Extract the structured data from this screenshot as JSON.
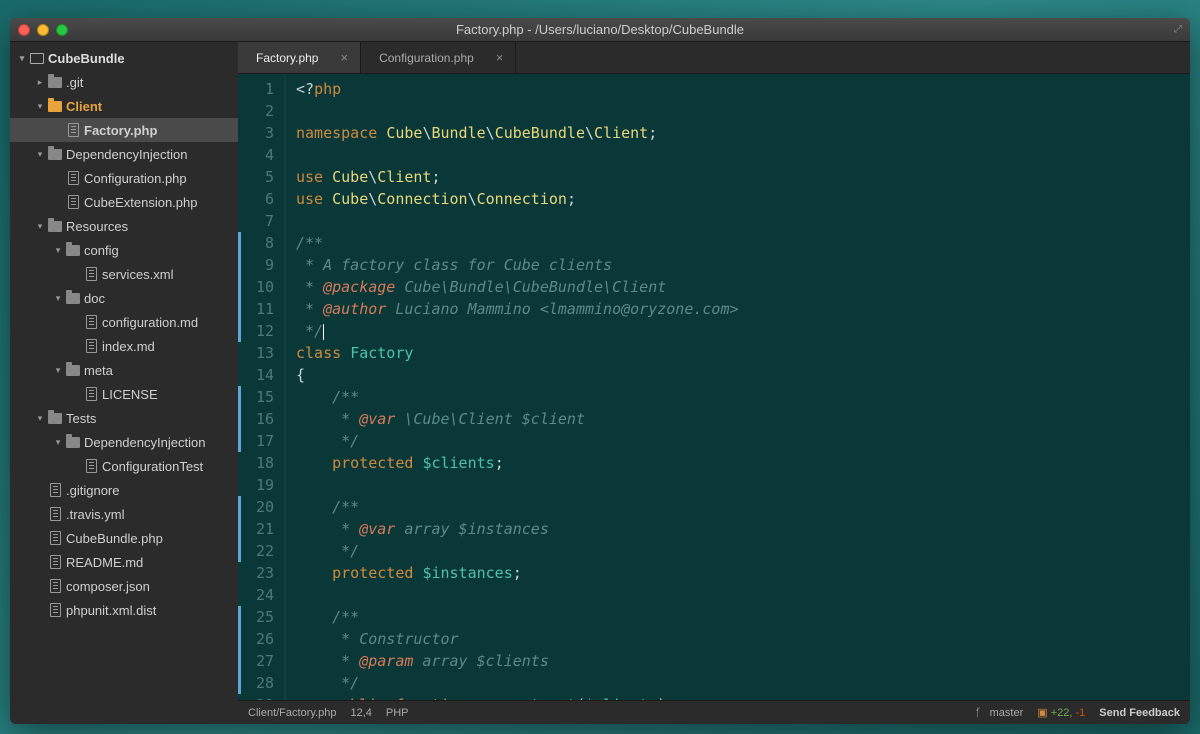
{
  "window": {
    "title": "Factory.php - /Users/luciano/Desktop/CubeBundle"
  },
  "sidebar": {
    "root": "CubeBundle",
    "items": [
      {
        "label": ".git",
        "type": "folder",
        "depth": 1,
        "expanded": false
      },
      {
        "label": "Client",
        "type": "folder",
        "depth": 1,
        "expanded": true,
        "active": true
      },
      {
        "label": "Factory.php",
        "type": "file",
        "depth": 2,
        "selected": true
      },
      {
        "label": "DependencyInjection",
        "type": "folder",
        "depth": 1,
        "expanded": true
      },
      {
        "label": "Configuration.php",
        "type": "file",
        "depth": 2
      },
      {
        "label": "CubeExtension.php",
        "type": "file",
        "depth": 2
      },
      {
        "label": "Resources",
        "type": "folder",
        "depth": 1,
        "expanded": true
      },
      {
        "label": "config",
        "type": "folder",
        "depth": 2,
        "expanded": true
      },
      {
        "label": "services.xml",
        "type": "file",
        "depth": 3
      },
      {
        "label": "doc",
        "type": "folder",
        "depth": 2,
        "expanded": true
      },
      {
        "label": "configuration.md",
        "type": "file",
        "depth": 3
      },
      {
        "label": "index.md",
        "type": "file",
        "depth": 3
      },
      {
        "label": "meta",
        "type": "folder",
        "depth": 2,
        "expanded": true
      },
      {
        "label": "LICENSE",
        "type": "file",
        "depth": 3
      },
      {
        "label": "Tests",
        "type": "folder",
        "depth": 1,
        "expanded": true
      },
      {
        "label": "DependencyInjection",
        "type": "folder",
        "depth": 2,
        "expanded": true
      },
      {
        "label": "ConfigurationTest",
        "type": "file",
        "depth": 3
      },
      {
        "label": ".gitignore",
        "type": "file",
        "depth": 1
      },
      {
        "label": ".travis.yml",
        "type": "file",
        "depth": 1
      },
      {
        "label": "CubeBundle.php",
        "type": "file",
        "depth": 1
      },
      {
        "label": "README.md",
        "type": "file",
        "depth": 1
      },
      {
        "label": "composer.json",
        "type": "file",
        "depth": 1
      },
      {
        "label": "phpunit.xml.dist",
        "type": "file",
        "depth": 1
      }
    ]
  },
  "tabs": [
    {
      "label": "Factory.php",
      "active": true
    },
    {
      "label": "Configuration.php",
      "active": false
    }
  ],
  "editor": {
    "modified_lines": [
      8,
      9,
      10,
      11,
      12,
      15,
      16,
      17,
      20,
      21,
      22,
      25,
      26,
      27,
      28
    ],
    "lines": [
      {
        "n": 1,
        "tokens": [
          [
            "punct",
            "<?"
          ],
          [
            "kw",
            "php"
          ]
        ]
      },
      {
        "n": 2,
        "tokens": []
      },
      {
        "n": 3,
        "tokens": [
          [
            "kw",
            "namespace "
          ],
          [
            "ns",
            "Cube"
          ],
          [
            "op",
            "\\"
          ],
          [
            "ns",
            "Bundle"
          ],
          [
            "op",
            "\\"
          ],
          [
            "ns",
            "CubeBundle"
          ],
          [
            "op",
            "\\"
          ],
          [
            "ns",
            "Client"
          ],
          [
            "punct",
            ";"
          ]
        ]
      },
      {
        "n": 4,
        "tokens": []
      },
      {
        "n": 5,
        "tokens": [
          [
            "kw",
            "use "
          ],
          [
            "ns",
            "Cube"
          ],
          [
            "op",
            "\\"
          ],
          [
            "ns",
            "Client"
          ],
          [
            "punct",
            ";"
          ]
        ]
      },
      {
        "n": 6,
        "tokens": [
          [
            "kw",
            "use "
          ],
          [
            "ns",
            "Cube"
          ],
          [
            "op",
            "\\"
          ],
          [
            "ns",
            "Connection"
          ],
          [
            "op",
            "\\"
          ],
          [
            "ns",
            "Connection"
          ],
          [
            "punct",
            ";"
          ]
        ]
      },
      {
        "n": 7,
        "tokens": []
      },
      {
        "n": 8,
        "tokens": [
          [
            "doc",
            "/**"
          ]
        ]
      },
      {
        "n": 9,
        "tokens": [
          [
            "doc",
            " * A factory class for Cube clients"
          ]
        ]
      },
      {
        "n": 10,
        "tokens": [
          [
            "doc",
            " * "
          ],
          [
            "tag",
            "@package"
          ],
          [
            "doc",
            " Cube\\Bundle\\CubeBundle\\Client"
          ]
        ]
      },
      {
        "n": 11,
        "tokens": [
          [
            "doc",
            " * "
          ],
          [
            "tag",
            "@author"
          ],
          [
            "doc",
            " Luciano Mammino <lmammino@oryzone.com>"
          ]
        ]
      },
      {
        "n": 12,
        "tokens": [
          [
            "doc",
            " */"
          ],
          [
            "cursor",
            ""
          ]
        ]
      },
      {
        "n": 13,
        "tokens": [
          [
            "kw",
            "class "
          ],
          [
            "cls",
            "Factory"
          ]
        ]
      },
      {
        "n": 14,
        "tokens": [
          [
            "punct",
            "{"
          ]
        ]
      },
      {
        "n": 15,
        "tokens": [
          [
            "doc",
            "    /**"
          ]
        ]
      },
      {
        "n": 16,
        "tokens": [
          [
            "doc",
            "     * "
          ],
          [
            "tag",
            "@var"
          ],
          [
            "doc",
            " \\Cube\\Client $client"
          ]
        ]
      },
      {
        "n": 17,
        "tokens": [
          [
            "doc",
            "     */"
          ]
        ]
      },
      {
        "n": 18,
        "tokens": [
          [
            "punct",
            "    "
          ],
          [
            "kw",
            "protected "
          ],
          [
            "var",
            "$clients"
          ],
          [
            "punct",
            ";"
          ]
        ]
      },
      {
        "n": 19,
        "tokens": []
      },
      {
        "n": 20,
        "tokens": [
          [
            "doc",
            "    /**"
          ]
        ]
      },
      {
        "n": 21,
        "tokens": [
          [
            "doc",
            "     * "
          ],
          [
            "tag",
            "@var"
          ],
          [
            "doc",
            " array $instances"
          ]
        ]
      },
      {
        "n": 22,
        "tokens": [
          [
            "doc",
            "     */"
          ]
        ]
      },
      {
        "n": 23,
        "tokens": [
          [
            "punct",
            "    "
          ],
          [
            "kw",
            "protected "
          ],
          [
            "var",
            "$instances"
          ],
          [
            "punct",
            ";"
          ]
        ]
      },
      {
        "n": 24,
        "tokens": []
      },
      {
        "n": 25,
        "tokens": [
          [
            "doc",
            "    /**"
          ]
        ]
      },
      {
        "n": 26,
        "tokens": [
          [
            "doc",
            "     * Constructor"
          ]
        ]
      },
      {
        "n": 27,
        "tokens": [
          [
            "doc",
            "     * "
          ],
          [
            "tag",
            "@param"
          ],
          [
            "doc",
            " array $clients"
          ]
        ]
      },
      {
        "n": 28,
        "tokens": [
          [
            "doc",
            "     */"
          ]
        ]
      },
      {
        "n": 29,
        "tokens": [
          [
            "punct",
            "    "
          ],
          [
            "kw",
            "public "
          ],
          [
            "kw",
            "function "
          ],
          [
            "fn",
            "__construct"
          ],
          [
            "punct",
            "("
          ],
          [
            "var",
            "$clients"
          ],
          [
            "punct",
            ")"
          ]
        ]
      }
    ]
  },
  "statusbar": {
    "path": "Client/Factory.php",
    "position": "12,4",
    "language": "PHP",
    "branch": "master",
    "diff_add": "+22,",
    "diff_del": "-1",
    "feedback": "Send Feedback"
  }
}
